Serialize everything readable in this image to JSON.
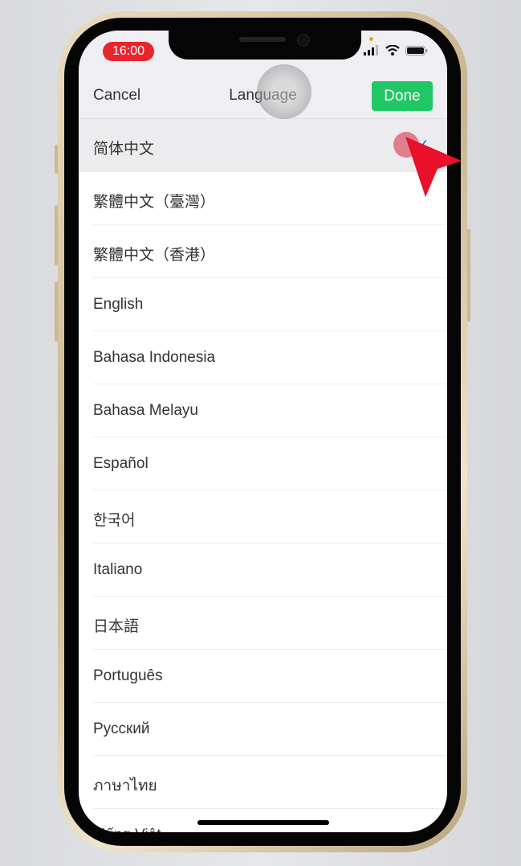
{
  "status_bar": {
    "time": "16:00",
    "icons": [
      "signal-icon",
      "wifi-icon",
      "battery-icon"
    ]
  },
  "nav": {
    "cancel": "Cancel",
    "title": "Language",
    "done": "Done"
  },
  "colors": {
    "done": "#20c764",
    "check": "#2f6fe0",
    "time_pill": "#e8252d",
    "pointer": "#e8102a"
  },
  "languages": [
    {
      "label": "简体中文",
      "selected": true
    },
    {
      "label": "繁體中文（臺灣）"
    },
    {
      "label": "繁體中文（香港）"
    },
    {
      "label": "English"
    },
    {
      "label": "Bahasa Indonesia"
    },
    {
      "label": "Bahasa Melayu"
    },
    {
      "label": "Español"
    },
    {
      "label": "한국어"
    },
    {
      "label": "Italiano"
    },
    {
      "label": "日本語"
    },
    {
      "label": "Português"
    },
    {
      "label": "Русский"
    },
    {
      "label": "ภาษาไทย"
    },
    {
      "label": "Tiếng Việt"
    }
  ],
  "check_glyph": "✓"
}
